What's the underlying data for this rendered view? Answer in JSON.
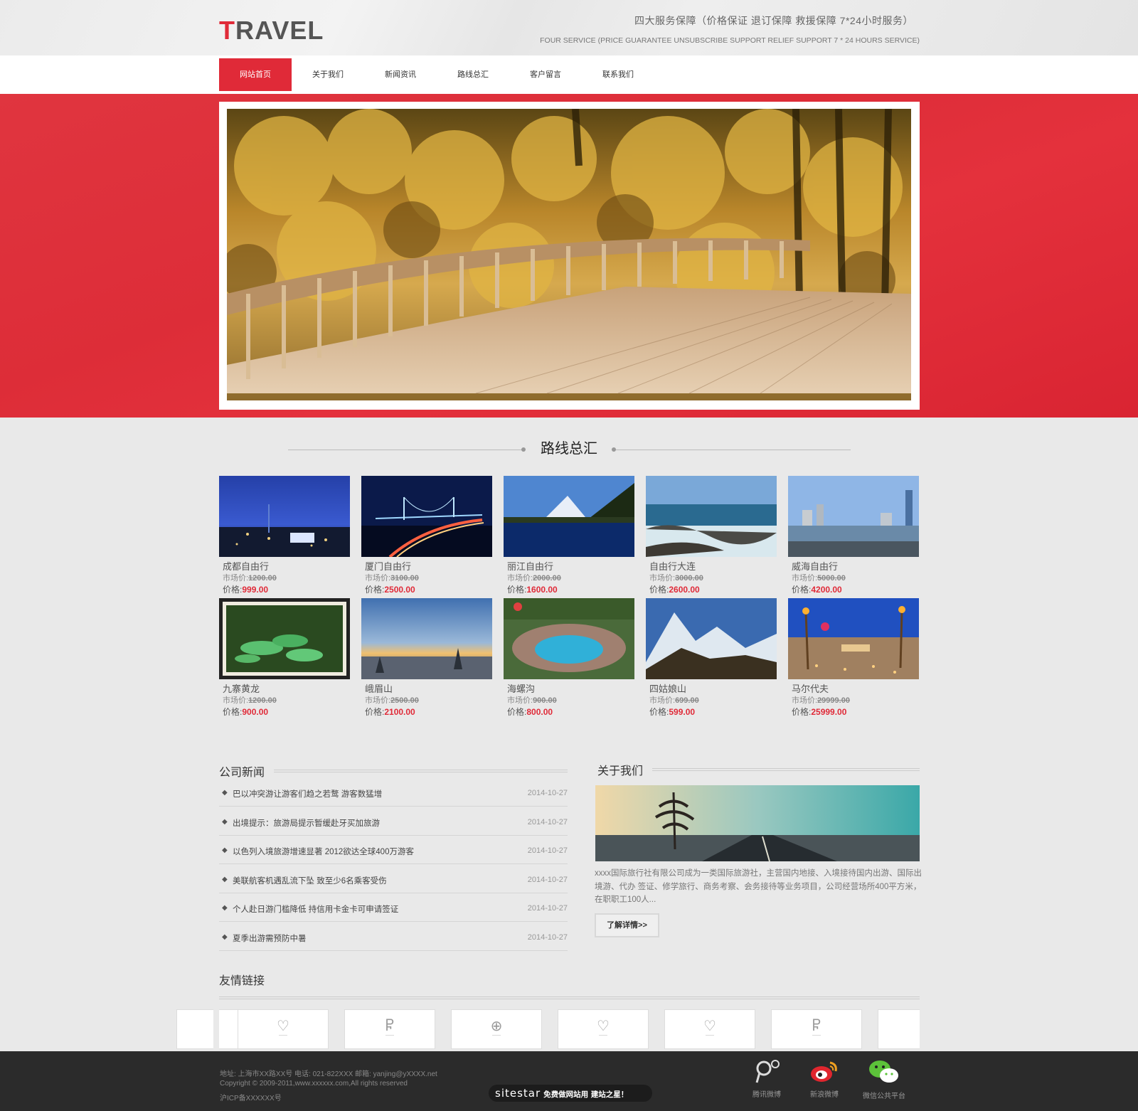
{
  "header": {
    "logo_first": "T",
    "logo_rest": "RAVEL",
    "service_cn": "四大服务保障（价格保证  退订保障  救援保障  7*24小时服务）",
    "service_en": "FOUR SERVICE (PRICE GUARANTEE UNSUBSCRIBE SUPPORT RELIEF SUPPORT 7 * 24 HOURS SERVICE)"
  },
  "nav": {
    "items": [
      "网站首页",
      "关于我们",
      "新闻资讯",
      "路线总汇",
      "客户留言",
      "联系我们"
    ],
    "active_index": 0
  },
  "routes": {
    "title": "路线总汇",
    "market_label": "市场价:",
    "price_label": "价格:",
    "items": [
      {
        "name": "成都自由行",
        "market": "1200.00",
        "price": "999.00"
      },
      {
        "name": "厦门自由行",
        "market": "3100.00",
        "price": "2500.00"
      },
      {
        "name": "丽江自由行",
        "market": "2000.00",
        "price": "1600.00"
      },
      {
        "name": "自由行大连",
        "market": "3000.00",
        "price": "2600.00"
      },
      {
        "name": "威海自由行",
        "market": "5000.00",
        "price": "4200.00"
      },
      {
        "name": "九寨黄龙",
        "market": "1200.00",
        "price": "900.00"
      },
      {
        "name": "峨眉山",
        "market": "2500.00",
        "price": "2100.00"
      },
      {
        "name": "海螺沟",
        "market": "900.00",
        "price": "800.00"
      },
      {
        "name": "四姑娘山",
        "market": "699.00",
        "price": "599.00"
      },
      {
        "name": "马尔代夫",
        "market": "29999.00",
        "price": "25999.00"
      }
    ]
  },
  "news": {
    "title": "公司新闻",
    "items": [
      {
        "title": "巴以冲突游让游客们趋之若鹜 游客数猛增",
        "date": "2014-10-27"
      },
      {
        "title": "出境提示：旅游局提示暂缓赴牙买加旅游",
        "date": "2014-10-27"
      },
      {
        "title": "以色列入境旅游增速显著 2012欲达全球400万游客",
        "date": "2014-10-27"
      },
      {
        "title": "美联航客机遇乱流下坠 致至少6名乘客受伤",
        "date": "2014-10-27"
      },
      {
        "title": "个人赴日游门槛降低 持信用卡金卡可申请签证",
        "date": "2014-10-27"
      },
      {
        "title": "夏季出游需预防中暑",
        "date": "2014-10-27"
      }
    ]
  },
  "about": {
    "title": "关于我们",
    "text": "xxxx国际旅行社有限公司成为一类国际旅游社，主营国内地接、入境接待国内出游、国际出境游、代办 签证、修学旅行、商务考察、会务接待等业务项目，公司经营场所400平方米，在职职工100人...",
    "more": "了解详情>>"
  },
  "links": {
    "title": "友情链接",
    "items": [
      {
        "name": "partner-logo-1"
      },
      {
        "name": "partner-logo-2"
      },
      {
        "name": "partner-logo-3"
      },
      {
        "name": "partner-logo-4"
      },
      {
        "name": "partner-logo-5"
      },
      {
        "name": "partner-logo-6"
      }
    ]
  },
  "footer": {
    "address": "地址: 上海市XX路XX号      电话: 021-822XXX      邮箱: yanjing@yXXXX.net",
    "copyright": "Copyright © 2009-2011,www.xxxxxx.com,All rights reserved",
    "icp": "沪ICP备XXXXXX号",
    "badge_brand": "sitestar",
    "badge_slogan": "免费做网站用 建站之星！",
    "social": [
      {
        "label": "腾讯微博",
        "icon": "tencent-weibo-icon"
      },
      {
        "label": "新浪微博",
        "icon": "sina-weibo-icon"
      },
      {
        "label": "微信公共平台",
        "icon": "wechat-icon"
      }
    ]
  },
  "colors": {
    "brand_red": "#e02a38",
    "footer_bg": "#2b2b2b"
  }
}
